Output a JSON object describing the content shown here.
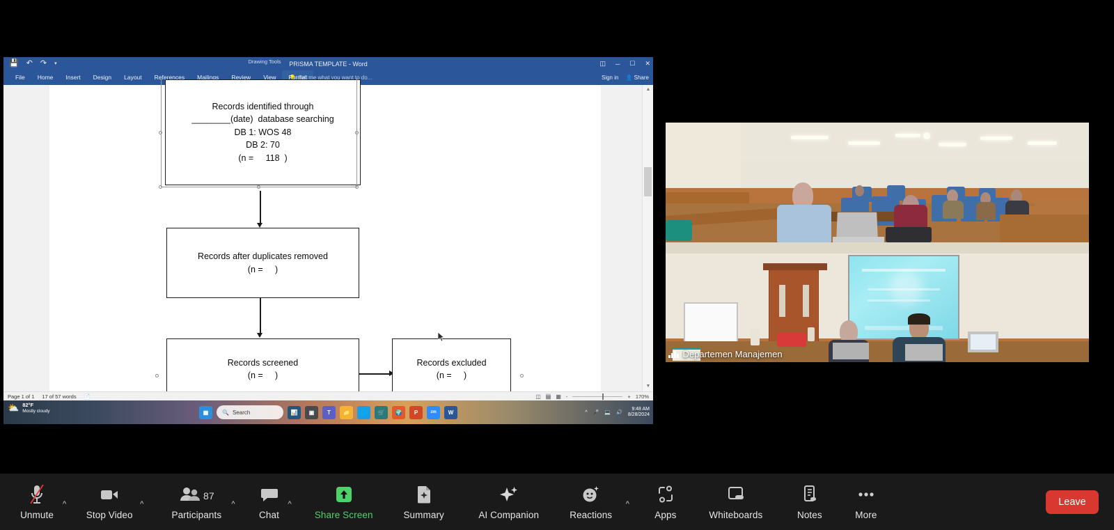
{
  "shared_screen": {
    "app_title": "PRISMA TEMPLATE - Word",
    "drawing_tools_label": "Drawing Tools",
    "tell_me_placeholder": "Tell me what you want to do...",
    "sign_in": "Sign in",
    "share": "Share",
    "ribbon_tabs": [
      {
        "label": "File"
      },
      {
        "label": "Home"
      },
      {
        "label": "Insert"
      },
      {
        "label": "Design"
      },
      {
        "label": "Layout"
      },
      {
        "label": "References"
      },
      {
        "label": "Mailings"
      },
      {
        "label": "Review"
      },
      {
        "label": "View"
      },
      {
        "label": "Format"
      }
    ],
    "quick_access": [
      "save-icon",
      "undo-icon",
      "redo-icon",
      "customize-icon"
    ],
    "window_controls": [
      "ribbon-display-options",
      "minimize",
      "restore",
      "close"
    ],
    "status_bar": {
      "page": "Page 1 of 1",
      "words": "17 of 57 words",
      "proofing": "proofing-icon",
      "zoom_level": "170%",
      "views": [
        "read-mode",
        "print-layout",
        "web-layout"
      ],
      "zoom_out": "-",
      "zoom_in": "+"
    },
    "flowchart": {
      "boxes": [
        {
          "id": "identification",
          "lines": [
            "Records identified through",
            "________(date)  database searching",
            "DB 1: WOS 48",
            "DB 2: 70",
            "(n =     118  )"
          ]
        },
        {
          "id": "duplicates-removed",
          "lines": [
            "Records after duplicates removed",
            "(n =     )"
          ]
        },
        {
          "id": "records-screened",
          "lines": [
            "Records screened",
            "(n =     )"
          ]
        },
        {
          "id": "records-excluded",
          "lines": [
            "Records excluded",
            "(n =     )"
          ]
        }
      ]
    }
  },
  "taskbar": {
    "weather_temp": "82°F",
    "weather_desc": "Mostly cloudy",
    "search_placeholder": "Search",
    "time": "9:48 AM",
    "date": "8/28/2024",
    "apps": [
      "start-icon",
      "search-box",
      "charts-icon",
      "news-icon",
      "teams-icon",
      "file-explorer-icon",
      "edge-icon",
      "store-icon",
      "firefox-icon",
      "powerpoint-icon",
      "zoom-icon",
      "word-icon"
    ],
    "tray": [
      "show-hidden-icons",
      "microphone-icon",
      "network-icon",
      "volume-icon"
    ]
  },
  "video": {
    "tiles": [
      {
        "name": "",
        "id": "classroom-tile"
      },
      {
        "name": "Departemen Manajemen",
        "id": "meeting-room-tile"
      }
    ],
    "active_speaker_label": "Departemen Manajemen"
  },
  "zoom_toolbar": {
    "items": [
      {
        "label": "Unmute",
        "icon": "microphone-muted-icon",
        "caret": true,
        "accent": false
      },
      {
        "label": "Stop Video",
        "icon": "video-camera-icon",
        "caret": true,
        "accent": false
      },
      {
        "label": "Participants",
        "icon": "participants-icon",
        "caret": true,
        "accent": false,
        "count": "87"
      },
      {
        "label": "Chat",
        "icon": "chat-bubble-icon",
        "caret": true,
        "accent": false
      },
      {
        "label": "Share Screen",
        "icon": "share-screen-up-arrow-icon",
        "caret": false,
        "accent": true
      },
      {
        "label": "Summary",
        "icon": "summary-doc-sparkle-icon",
        "caret": false,
        "accent": false
      },
      {
        "label": "AI Companion",
        "icon": "ai-sparkle-icon",
        "caret": false,
        "accent": false
      },
      {
        "label": "Reactions",
        "icon": "reactions-smiley-icon",
        "caret": true,
        "accent": false
      },
      {
        "label": "Apps",
        "icon": "apps-icon",
        "caret": false,
        "accent": false
      },
      {
        "label": "Whiteboards",
        "icon": "whiteboard-icon",
        "caret": false,
        "accent": false
      },
      {
        "label": "Notes",
        "icon": "notes-icon",
        "caret": false,
        "accent": false
      },
      {
        "label": "More",
        "icon": "more-ellipsis-icon",
        "caret": false,
        "accent": false
      }
    ],
    "leave_label": "Leave",
    "leave_color": "#d8382f",
    "accent_color": "#4ad36a"
  }
}
